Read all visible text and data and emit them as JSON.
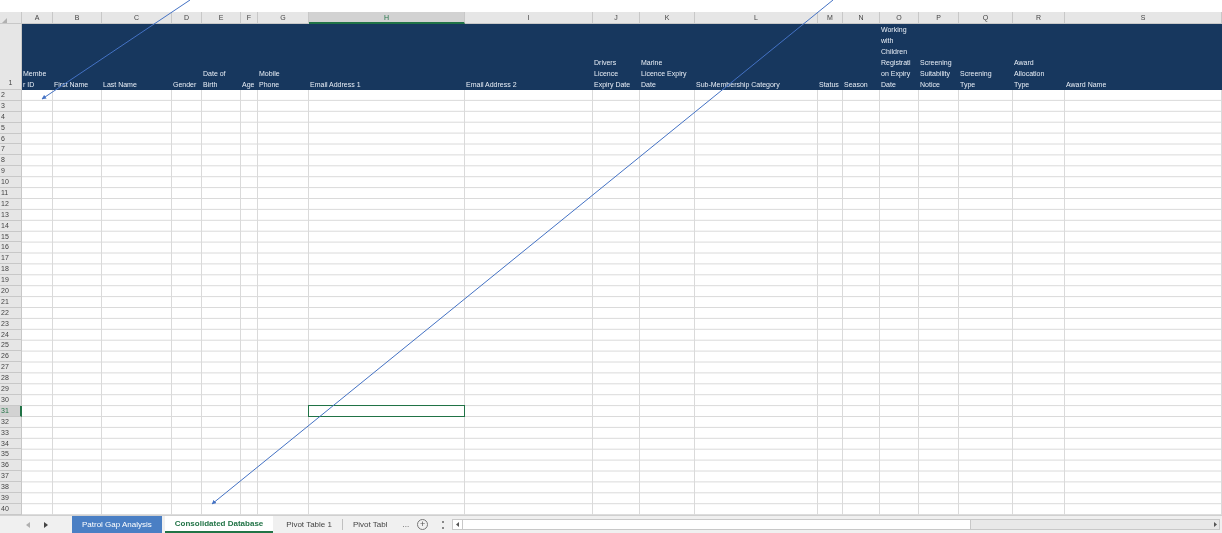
{
  "columns": [
    {
      "letter": "A",
      "header": "Membe\nr ID",
      "selected": false
    },
    {
      "letter": "B",
      "header": "First Name",
      "selected": false
    },
    {
      "letter": "C",
      "header": "Last Name",
      "selected": false
    },
    {
      "letter": "D",
      "header": "Gender",
      "selected": false
    },
    {
      "letter": "E",
      "header": "Date of\nBirth",
      "selected": false
    },
    {
      "letter": "F",
      "header": "Age",
      "selected": false
    },
    {
      "letter": "G",
      "header": "Mobile\nPhone",
      "selected": false
    },
    {
      "letter": "H",
      "header": "Email Address 1",
      "selected": true
    },
    {
      "letter": "I",
      "header": "Email Address 2",
      "selected": false
    },
    {
      "letter": "J",
      "header": "Drivers\nLicence\nExpiry Date",
      "selected": false
    },
    {
      "letter": "K",
      "header": "Marine\nLicence Expiry\nDate",
      "selected": false
    },
    {
      "letter": "L",
      "header": "Sub-Membership Category",
      "selected": false
    },
    {
      "letter": "M",
      "header": "Status",
      "selected": false
    },
    {
      "letter": "N",
      "header": "Season",
      "selected": false
    },
    {
      "letter": "O",
      "header": "Working\nwith\nChildren\nRegistrati\non Expiry\nDate",
      "selected": false
    },
    {
      "letter": "P",
      "header": "Screening\nSuitability\nNotice",
      "selected": false
    },
    {
      "letter": "Q",
      "header": "Screening\nType",
      "selected": false
    },
    {
      "letter": "R",
      "header": "Award\nAllocation\nType",
      "selected": false
    },
    {
      "letter": "S",
      "header": "Award Name",
      "selected": false
    }
  ],
  "header_row_number": "1",
  "rows": [
    {
      "number": "2",
      "selected": false
    },
    {
      "number": "3",
      "selected": false
    },
    {
      "number": "4",
      "selected": false
    },
    {
      "number": "5",
      "selected": false
    },
    {
      "number": "6",
      "selected": false
    },
    {
      "number": "7",
      "selected": false
    },
    {
      "number": "8",
      "selected": false
    },
    {
      "number": "9",
      "selected": false
    },
    {
      "number": "10",
      "selected": false
    },
    {
      "number": "11",
      "selected": false
    },
    {
      "number": "12",
      "selected": false
    },
    {
      "number": "13",
      "selected": false
    },
    {
      "number": "14",
      "selected": false
    },
    {
      "number": "15",
      "selected": false
    },
    {
      "number": "16",
      "selected": false
    },
    {
      "number": "17",
      "selected": false
    },
    {
      "number": "18",
      "selected": false
    },
    {
      "number": "19",
      "selected": false
    },
    {
      "number": "20",
      "selected": false
    },
    {
      "number": "21",
      "selected": false
    },
    {
      "number": "22",
      "selected": false
    },
    {
      "number": "23",
      "selected": false
    },
    {
      "number": "24",
      "selected": false
    },
    {
      "number": "25",
      "selected": false
    },
    {
      "number": "26",
      "selected": false
    },
    {
      "number": "27",
      "selected": false
    },
    {
      "number": "28",
      "selected": false
    },
    {
      "number": "29",
      "selected": false
    },
    {
      "number": "30",
      "selected": false
    },
    {
      "number": "31",
      "selected": true
    },
    {
      "number": "32",
      "selected": false
    },
    {
      "number": "33",
      "selected": false
    },
    {
      "number": "34",
      "selected": false
    },
    {
      "number": "35",
      "selected": false
    },
    {
      "number": "36",
      "selected": false
    },
    {
      "number": "37",
      "selected": false
    },
    {
      "number": "38",
      "selected": false
    },
    {
      "number": "39",
      "selected": false
    },
    {
      "number": "40",
      "selected": false
    }
  ],
  "sheet_tabs": [
    {
      "label": "Patrol Gap Analysis",
      "selected": false,
      "color": "#4a7fc4"
    },
    {
      "label": "Consolidated Database",
      "selected": true
    },
    {
      "label": "Pivot Table 1",
      "selected": false
    },
    {
      "label": "Pivot Tabl",
      "selected": false
    }
  ],
  "more_tabs": "...",
  "add_sheet": "+"
}
